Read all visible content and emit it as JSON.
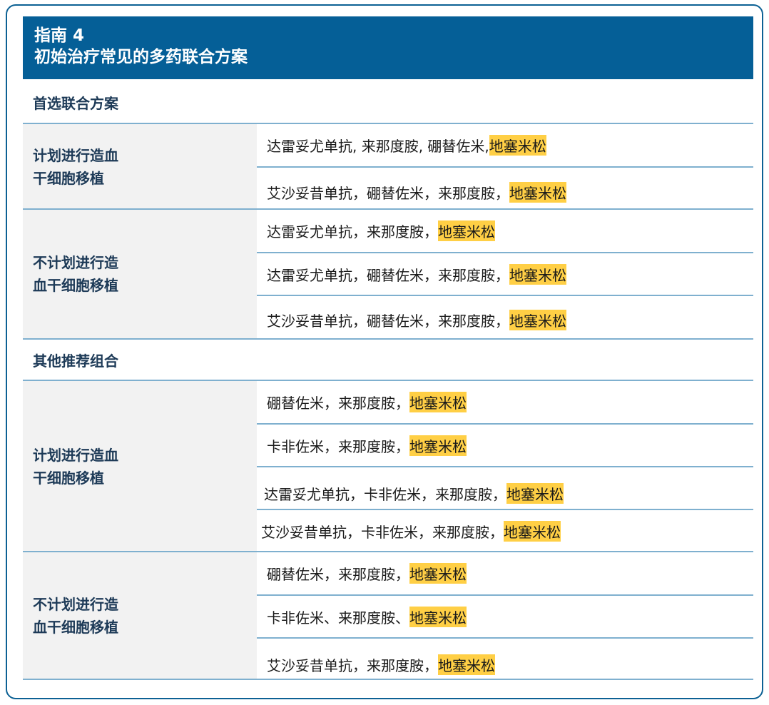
{
  "header": {
    "title_line1": "指南 4",
    "title_line2": "初始治疗常见的多药联合方案"
  },
  "colors": {
    "header_bg": "#055f97",
    "highlight": "#ffcf45",
    "divider": "#7fb0cf",
    "label_bg": "#f2f2f2"
  },
  "preferred": {
    "heading": "首选联合方案",
    "groups": [
      {
        "label": "计划进行造血\n干细胞移植",
        "regimens": [
          {
            "text": "达雷妥尤单抗, 来那度胺, 硼替佐米, ",
            "highlight": "地塞米松"
          },
          {
            "text": "艾沙妥昔单抗，硼替佐米，来那度胺，",
            "highlight": "地塞米松"
          }
        ]
      },
      {
        "label": "不计划进行造\n血干细胞移植",
        "regimens": [
          {
            "text": "达雷妥尤单抗，来那度胺，",
            "highlight": "地塞米松"
          },
          {
            "text": "达雷妥尤单抗，硼替佐米，来那度胺，",
            "highlight": "地塞米松"
          },
          {
            "text": "艾沙妥昔单抗，硼替佐米，来那度胺，",
            "highlight": "地塞米松"
          }
        ]
      }
    ]
  },
  "other": {
    "heading": "其他推荐组合",
    "groups": [
      {
        "label": "计划进行造血\n干细胞移植",
        "regimens": [
          {
            "text": "硼替佐米，来那度胺，",
            "highlight": "地塞米松"
          },
          {
            "text": "卡非佐米，来那度胺，",
            "highlight": "地塞米松"
          },
          {
            "text": "达雷妥尤单抗，卡非佐米，来那度胺，",
            "highlight": "地塞米松"
          },
          {
            "text": "艾沙妥昔单抗，卡非佐米，来那度胺，",
            "highlight": "地塞米松"
          }
        ]
      },
      {
        "label": "不计划进行造\n血干细胞移植",
        "regimens": [
          {
            "text": "硼替佐米，来那度胺，",
            "highlight": "地塞米松"
          },
          {
            "text": "卡非佐米、来那度胺、",
            "highlight": "地塞米松"
          },
          {
            "text": "艾沙妥昔单抗，来那度胺，",
            "highlight": "地塞米松"
          }
        ]
      }
    ]
  }
}
